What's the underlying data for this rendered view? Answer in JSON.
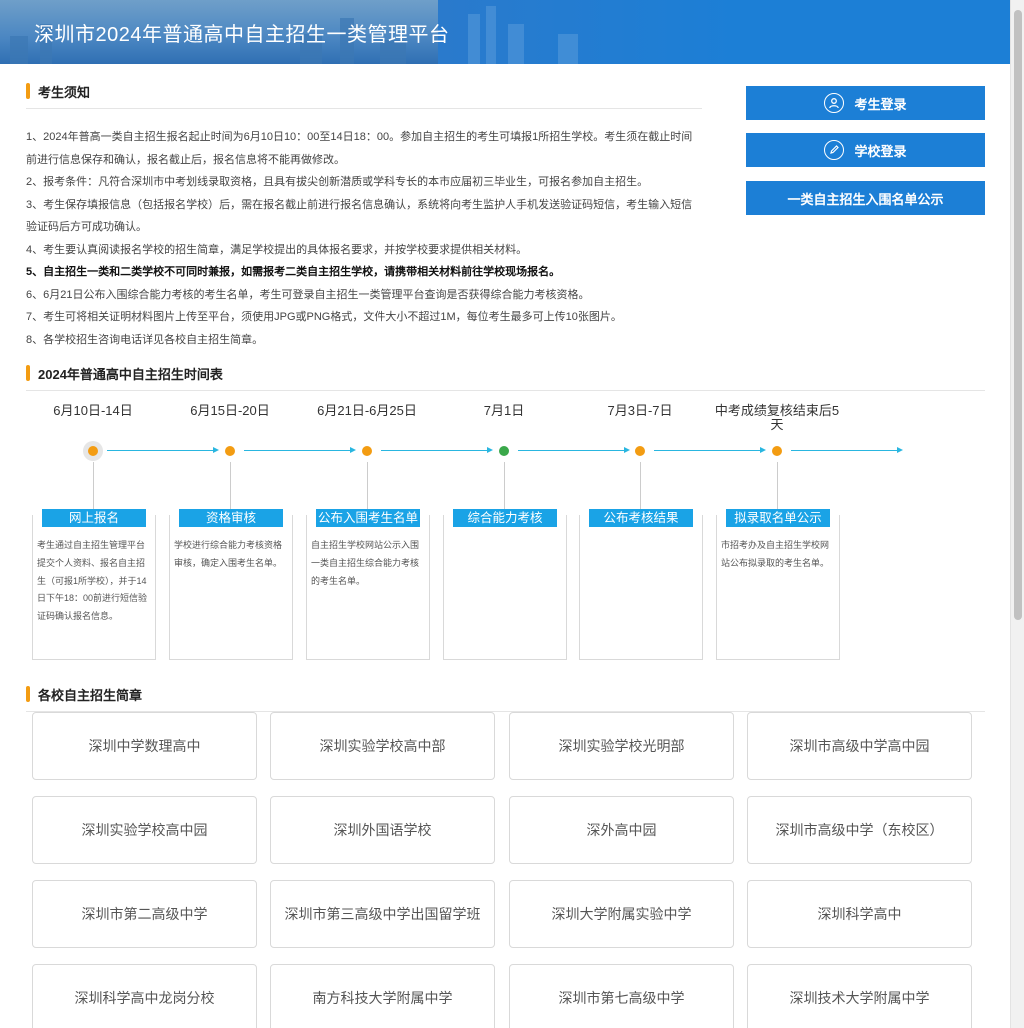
{
  "header": {
    "title": "深圳市2024年普通高中自主招生一类管理平台"
  },
  "notice": {
    "heading": "考生须知",
    "items": [
      "1、2024年普高一类自主招生报名起止时间为6月10日10：00至14日18：00。参加自主招生的考生可填报1所招生学校。考生须在截止时间前进行信息保存和确认，报名截止后，报名信息将不能再做修改。",
      "2、报考条件：凡符合深圳市中考划线录取资格，且具有拔尖创新潜质或学科专长的本市应届初三毕业生，可报名参加自主招生。",
      "3、考生保存填报信息（包括报名学校）后，需在报名截止前进行报名信息确认，系统将向考生监护人手机发送验证码短信，考生输入短信验证码后方可成功确认。",
      "4、考生要认真阅读报名学校的招生简章，满足学校提出的具体报名要求，并按学校要求提供相关材料。",
      "5、自主招生一类和二类学校不可同时兼报，如需报考二类自主招生学校，请携带相关材料前往学校现场报名。",
      "6、6月21日公布入围综合能力考核的考生名单，考生可登录自主招生一类管理平台查询是否获得综合能力考核资格。",
      "7、考生可将相关证明材料图片上传至平台，须使用JPG或PNG格式，文件大小不超过1M，每位考生最多可上传10张图片。",
      "8、各学校招生咨询电话详见各校自主招生简章。"
    ]
  },
  "side": {
    "student_login": "考生登录",
    "school_login": "学校登录",
    "shortlist": "一类自主招生入围名单公示"
  },
  "timeline": {
    "heading": "2024年普通高中自主招生时间表",
    "steps": [
      {
        "date": "6月10日-14日",
        "title": "网上报名",
        "desc": "考生通过自主招生管理平台提交个人资料、报名自主招生（可报1所学校），并于14日下午18：00前进行短信验证码确认报名信息。",
        "dot_color": "#f39c12"
      },
      {
        "date": "6月15日-20日",
        "title": "资格审核",
        "desc": "学校进行综合能力考核资格审核，确定入围考生名单。",
        "dot_color": "#f39c12"
      },
      {
        "date": "6月21日-6月25日",
        "title": "公布入围考生名单",
        "desc": "自主招生学校网站公示入围一类自主招生综合能力考核的考生名单。",
        "dot_color": "#f39c12"
      },
      {
        "date": "7月1日",
        "title": "综合能力考核",
        "desc": "",
        "dot_color": "#3aa84a"
      },
      {
        "date": "7月3日-7日",
        "title": "公布考核结果",
        "desc": "",
        "dot_color": "#f39c12"
      },
      {
        "date": "中考成绩复核结束后5天",
        "title": "拟录取名单公示",
        "desc": "市招考办及自主招生学校网站公布拟录取的考生名单。",
        "dot_color": "#f39c12"
      }
    ]
  },
  "schools": {
    "heading": "各校自主招生简章",
    "items": [
      "深圳中学数理高中",
      "深圳实验学校高中部",
      "深圳实验学校光明部",
      "深圳市高级中学高中园",
      "深圳实验学校高中园",
      "深圳外国语学校",
      "深外高中园",
      "深圳市高级中学（东校区）",
      "深圳市第二高级中学",
      "深圳市第三高级中学出国留学班",
      "深圳大学附属实验中学",
      "深圳科学高中",
      "深圳科学高中龙岗分校",
      "南方科技大学附属中学",
      "深圳市第七高级中学",
      "深圳技术大学附属中学"
    ]
  },
  "colors": {
    "primary": "#1c7fd6",
    "accent": "#f39c12",
    "tab": "#1aa3e6",
    "arrow": "#29b6e0",
    "green": "#3aa84a"
  }
}
